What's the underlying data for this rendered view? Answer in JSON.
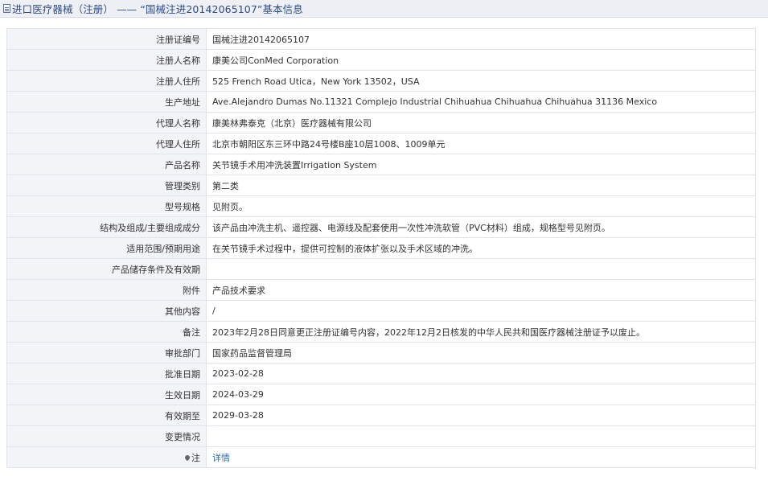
{
  "header": {
    "title": "进口医疗器械（注册） —— “国械注进20142065107”基本信息"
  },
  "rows": [
    {
      "label": "注册证编号",
      "value": "国械注进20142065107"
    },
    {
      "label": "注册人名称",
      "value": "康美公司ConMed Corporation"
    },
    {
      "label": "注册人住所",
      "value": "525 French Road Utica，New York 13502，USA"
    },
    {
      "label": "生产地址",
      "value": "Ave.Alejandro Dumas No.11321 Complejo Industrial Chihuahua Chihuahua Chihuahua 31136 Mexico"
    },
    {
      "label": "代理人名称",
      "value": "康美林弗泰克（北京）医疗器械有限公司"
    },
    {
      "label": "代理人住所",
      "value": "北京市朝阳区东三环中路24号楼B座10层1008、1009单元"
    },
    {
      "label": "产品名称",
      "value": "关节镜手术用冲洗装置Irrigation System"
    },
    {
      "label": "管理类别",
      "value": "第二类"
    },
    {
      "label": "型号规格",
      "value": "见附页。"
    },
    {
      "label": "结构及组成/主要组成成分",
      "value": "该产品由冲洗主机、遥控器、电源线及配套使用一次性冲洗软管（PVC材料）组成，规格型号见附页。"
    },
    {
      "label": "适用范围/预期用途",
      "value": "在关节镜手术过程中，提供可控制的液体扩张以及手术区域的冲洗。"
    },
    {
      "label": "产品储存条件及有效期",
      "value": ""
    },
    {
      "label": "附件",
      "value": "产品技术要求"
    },
    {
      "label": "其他内容",
      "value": "/"
    },
    {
      "label": "备注",
      "value": "2023年2月28日同意更正注册证编号内容，2022年12月2日核发的中华人民共和国医疗器械注册证予以废止。"
    },
    {
      "label": "审批部门",
      "value": "国家药品监督管理局"
    },
    {
      "label": "批准日期",
      "value": "2023-02-28"
    },
    {
      "label": "生效日期",
      "value": "2024-03-29"
    },
    {
      "label": "有效期至",
      "value": "2029-03-28"
    },
    {
      "label": "变更情况",
      "value": ""
    }
  ],
  "note_row": {
    "label": "注",
    "icon": "pin-icon",
    "link_text": "详情"
  },
  "colors": {
    "header_bg": "#eef0f5",
    "header_text": "#2c4a8a",
    "label_bg": "#f3f4f7",
    "border": "#dfe3ea",
    "link": "#2c6db5"
  }
}
